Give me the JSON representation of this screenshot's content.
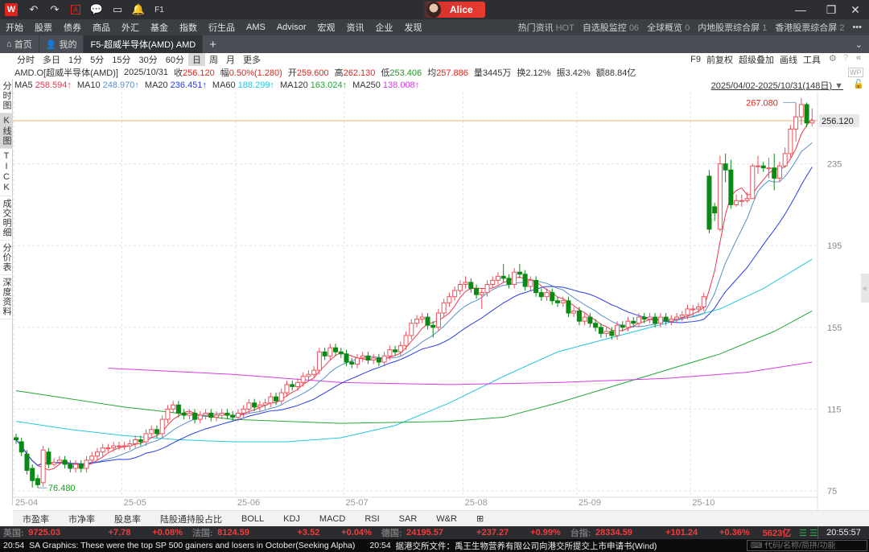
{
  "titlebar": {
    "logo": "W",
    "user": "Alice",
    "icons": [
      "undo-icon",
      "redo-icon",
      "font-a-icon",
      "chat-icon",
      "wp-monitor-icon",
      "bell-icon",
      "f1-help-icon"
    ]
  },
  "menu": {
    "items": [
      "开始",
      "股票",
      "债券",
      "商品",
      "外汇",
      "基金",
      "指数",
      "衍生品",
      "AMS",
      "Advisor",
      "宏观",
      "资讯",
      "企业",
      "发现"
    ],
    "right": [
      {
        "label": "热门资讯",
        "count": "HOT"
      },
      {
        "label": "自选股监控",
        "count": "06"
      },
      {
        "label": "全球概览",
        "count": "0"
      },
      {
        "label": "内地股票综合屏",
        "count": "1"
      },
      {
        "label": "香港股票综合屏",
        "count": "2"
      }
    ],
    "more": "•••"
  },
  "tabs": {
    "home": "首页",
    "mine": "我的",
    "active": "F5-超威半导体(AMD) AMD",
    "add": "+"
  },
  "periods": [
    "分时",
    "多日",
    "1分",
    "5分",
    "15分",
    "30分",
    "60分",
    "日",
    "周",
    "月",
    "更多"
  ],
  "selected_period": "日",
  "tools": [
    "F9",
    "前复权",
    "超级叠加",
    "画线",
    "工具"
  ],
  "side_tabs": [
    "分时图",
    "K线图",
    "TICK",
    "成交明细",
    "分价表",
    "深度资料"
  ],
  "quote": {
    "code": "AMD.O[超威半导体(AMD)]",
    "date": "2025/10/31",
    "close_l": "收",
    "close": "256.120",
    "chg_l": "幅",
    "chg": "0.50%(1.280)",
    "open_l": "开",
    "open": "259.600",
    "high_l": "高",
    "high": "262.130",
    "low_l": "低",
    "low": "253.406",
    "avg_l": "均",
    "avg": "257.886",
    "vol_l": "量",
    "vol": "3445万",
    "turn_l": "换",
    "turn": "2.12%",
    "amp_l": "振",
    "amp": "3.42%",
    "amt_l": "额",
    "amt": "88.84亿"
  },
  "ma": [
    {
      "name": "MA5",
      "value": "258.594↑",
      "color": "#e8384f"
    },
    {
      "name": "MA10",
      "value": "248.970↑",
      "color": "#5b8fc9"
    },
    {
      "name": "MA20",
      "value": "236.451↑",
      "color": "#2a3de8"
    },
    {
      "name": "MA60",
      "value": "188.299↑",
      "color": "#27c6e0"
    },
    {
      "name": "MA120",
      "value": "163.024↑",
      "color": "#22a838"
    },
    {
      "name": "MA250",
      "value": "138.008↑",
      "color": "#d63be8"
    }
  ],
  "range": "2025/04/02-2025/10/31(148日)",
  "indicators": [
    "市盈率",
    "市净率",
    "股息率",
    "陆股通持股占比",
    "BOLL",
    "KDJ",
    "MACD",
    "RSI",
    "SAR",
    "W&R",
    "⊞"
  ],
  "ticker": [
    {
      "label": "英国:",
      "value": "9725.03",
      "chg": "+7.78",
      "pct": "+0.08%"
    },
    {
      "label": "法国:",
      "value": "8124.59",
      "chg": "+3.52",
      "pct": "+0.04%"
    },
    {
      "label": "德国:",
      "value": "24195.57",
      "chg": "+237.27",
      "pct": "+0.99%"
    },
    {
      "label": "台指:",
      "value": "28334.59",
      "chg": "+101.24",
      "pct": "+0.36%"
    }
  ],
  "ticker_amount": "5623亿",
  "clock": "20:55:57",
  "news": [
    {
      "time": "20:54",
      "text": "SA Graphics: These were the top SP 500 gainers and losers in October(Seeking Alpha)"
    },
    {
      "time": "20:54",
      "text": "据港交所文件：禹王生物营养有限公司向港交所提交上市申请书(Wind)"
    }
  ],
  "search_placeholder": "代码/名称/简拼/功能",
  "colors": {
    "up": "#f0505a",
    "down": "#0a8a14",
    "price_line": "#f9c99b"
  },
  "chart_data": {
    "type": "candlestick",
    "x_ticks": [
      {
        "label": "25-04",
        "index": 0
      },
      {
        "label": "25-05",
        "index": 20
      },
      {
        "label": "25-06",
        "index": 41
      },
      {
        "label": "25-07",
        "index": 61
      },
      {
        "label": "25-08",
        "index": 83
      },
      {
        "label": "25-09",
        "index": 104
      },
      {
        "label": "25-10",
        "index": 125
      }
    ],
    "y_ticks": [
      75,
      115,
      155,
      195,
      235
    ],
    "ylim": [
      70,
      275
    ],
    "last_price": "256.120",
    "max_label": "267.080",
    "min_label": "76.480",
    "max_index": 144,
    "min_index": 4,
    "open": [
      101,
      99,
      93,
      86,
      81,
      79,
      94,
      88,
      89,
      90,
      88,
      86,
      88,
      86,
      90,
      92,
      94,
      96,
      96,
      97,
      97,
      97,
      98,
      100,
      99,
      103,
      105,
      103,
      110,
      115,
      117,
      113,
      112,
      113,
      110,
      112,
      113,
      111,
      112,
      113,
      112,
      111,
      113,
      115,
      118,
      116,
      117,
      118,
      121,
      119,
      123,
      127,
      126,
      128,
      131,
      132,
      134,
      143,
      141,
      145,
      143,
      142,
      138,
      137,
      140,
      141,
      139,
      140,
      138,
      141,
      144,
      143,
      146,
      151,
      157,
      159,
      160,
      156,
      155,
      162,
      167,
      170,
      173,
      176,
      177,
      174,
      171,
      172,
      176,
      178,
      180,
      179,
      176,
      182,
      181,
      175,
      178,
      172,
      170,
      172,
      168,
      167,
      168,
      162,
      163,
      158,
      160,
      157,
      155,
      152,
      153,
      151,
      156,
      155,
      158,
      157,
      160,
      159,
      160,
      157,
      160,
      158,
      159,
      160,
      161,
      164,
      164,
      165,
      229,
      214,
      203,
      235,
      232,
      215,
      217,
      217,
      218,
      234,
      234,
      233,
      233,
      228,
      234,
      240,
      252,
      258,
      264,
      255
    ],
    "high": [
      103,
      101,
      95,
      88,
      83,
      97,
      96,
      91,
      92,
      92,
      90,
      90,
      90,
      92,
      94,
      96,
      98,
      98,
      99,
      99,
      99,
      100,
      102,
      102,
      105,
      107,
      107,
      112,
      117,
      119,
      119,
      115,
      115,
      115,
      114,
      115,
      115,
      114,
      115,
      115,
      114,
      115,
      117,
      120,
      120,
      119,
      120,
      123,
      123,
      125,
      129,
      129,
      130,
      133,
      134,
      136,
      145,
      145,
      147,
      147,
      145,
      144,
      140,
      142,
      143,
      143,
      142,
      142,
      143,
      146,
      146,
      148,
      153,
      159,
      161,
      162,
      162,
      158,
      164,
      169,
      172,
      175,
      178,
      180,
      179,
      176,
      174,
      178,
      180,
      182,
      186,
      181,
      184,
      186,
      183,
      180,
      180,
      174,
      174,
      174,
      170,
      170,
      170,
      165,
      165,
      162,
      162,
      159,
      157,
      155,
      155,
      158,
      158,
      160,
      160,
      162,
      162,
      162,
      162,
      162,
      162,
      161,
      162,
      163,
      166,
      166,
      167,
      172,
      232,
      216,
      239,
      240,
      237,
      220,
      220,
      221,
      235,
      239,
      236,
      238,
      240,
      236,
      243,
      254,
      265,
      267.08,
      265,
      262.13
    ],
    "low": [
      98,
      92,
      83,
      76.6,
      76.48,
      77,
      86,
      87,
      88,
      86,
      84,
      84,
      84,
      84,
      88,
      90,
      92,
      94,
      94,
      95,
      95,
      95,
      96,
      97,
      97,
      101,
      101,
      101,
      108,
      113,
      111,
      110,
      110,
      108,
      108,
      110,
      109,
      109,
      110,
      110,
      109,
      109,
      111,
      113,
      114,
      114,
      115,
      116,
      117,
      117,
      121,
      124,
      124,
      126,
      129,
      130,
      132,
      139,
      139,
      141,
      140,
      136,
      135,
      135,
      138,
      137,
      137,
      136,
      136,
      139,
      141,
      141,
      144,
      149,
      155,
      157,
      154,
      150,
      153,
      160,
      165,
      168,
      171,
      174,
      172,
      169,
      164,
      170,
      174,
      176,
      177,
      174,
      174,
      179,
      173,
      173,
      170,
      168,
      168,
      166,
      165,
      165,
      160,
      160,
      156,
      156,
      155,
      153,
      150,
      150,
      149,
      149,
      153,
      153,
      155,
      155,
      157,
      157,
      155,
      155,
      156,
      156,
      157,
      158,
      159,
      160,
      162,
      163,
      201,
      207,
      202,
      226,
      213,
      214,
      214,
      216,
      218,
      230,
      231,
      228,
      222,
      226,
      233,
      238,
      246,
      254,
      253,
      253.41
    ],
    "close": [
      100,
      94,
      85,
      80,
      78,
      95,
      88,
      89,
      90,
      88,
      86,
      88,
      86,
      90,
      92,
      94,
      96,
      96,
      97,
      97,
      97,
      98,
      100,
      99,
      103,
      105,
      103,
      110,
      115,
      117,
      113,
      112,
      113,
      110,
      112,
      113,
      111,
      112,
      113,
      112,
      111,
      113,
      115,
      118,
      116,
      117,
      118,
      121,
      119,
      123,
      127,
      126,
      128,
      131,
      132,
      134,
      143,
      141,
      145,
      143,
      142,
      138,
      137,
      140,
      141,
      139,
      140,
      138,
      141,
      144,
      143,
      146,
      151,
      157,
      159,
      160,
      156,
      155,
      162,
      167,
      170,
      173,
      176,
      177,
      174,
      171,
      172,
      176,
      178,
      180,
      179,
      176,
      182,
      181,
      175,
      178,
      172,
      170,
      172,
      168,
      167,
      168,
      162,
      163,
      158,
      160,
      157,
      155,
      152,
      153,
      151,
      156,
      155,
      158,
      157,
      160,
      159,
      160,
      157,
      160,
      158,
      159,
      160,
      161,
      164,
      164,
      165,
      170,
      203,
      211,
      235,
      232,
      215,
      217,
      217,
      218,
      234,
      234,
      233,
      233,
      228,
      234,
      240,
      252,
      258,
      264,
      255,
      256.12
    ],
    "ma_long": {
      "MA60": [
        [
          0,
          109
        ],
        [
          10,
          105
        ],
        [
          20,
          102
        ],
        [
          30,
          100
        ],
        [
          40,
          99
        ],
        [
          50,
          99
        ],
        [
          60,
          101
        ],
        [
          70,
          107
        ],
        [
          80,
          118
        ],
        [
          90,
          131
        ],
        [
          100,
          143
        ],
        [
          110,
          150
        ],
        [
          120,
          157
        ],
        [
          130,
          164
        ],
        [
          138,
          174
        ],
        [
          147,
          188.3
        ]
      ],
      "MA120": [
        [
          0,
          124
        ],
        [
          20,
          116
        ],
        [
          40,
          110
        ],
        [
          60,
          108
        ],
        [
          80,
          109
        ],
        [
          90,
          111
        ],
        [
          100,
          118
        ],
        [
          110,
          126
        ],
        [
          120,
          134
        ],
        [
          130,
          142
        ],
        [
          140,
          153
        ],
        [
          147,
          163
        ]
      ],
      "MA250": [
        [
          17,
          135
        ],
        [
          40,
          132
        ],
        [
          60,
          128
        ],
        [
          80,
          127
        ],
        [
          100,
          128
        ],
        [
          120,
          130
        ],
        [
          135,
          133
        ],
        [
          147,
          138
        ]
      ]
    }
  }
}
